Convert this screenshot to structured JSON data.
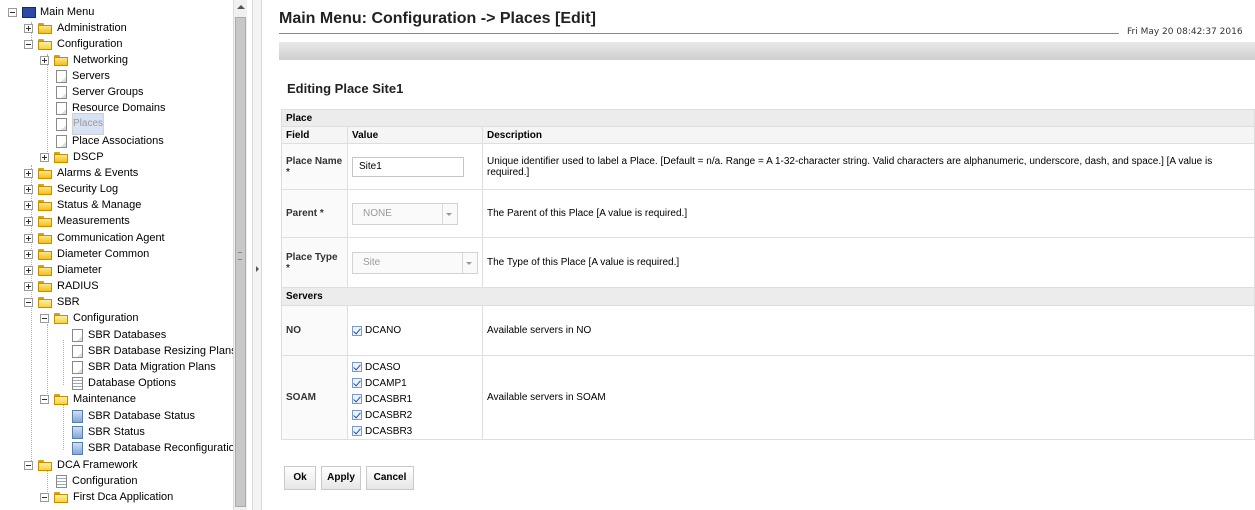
{
  "tree": {
    "items": [
      {
        "label": "Main Menu",
        "icon": "monitor-icon",
        "toggle": "minus"
      },
      {
        "label": "Administration",
        "icon": "folder-icon",
        "toggle": "plus"
      },
      {
        "label": "Configuration",
        "icon": "folder-open-icon",
        "toggle": "minus"
      },
      {
        "label": "Networking",
        "icon": "folder-icon",
        "toggle": "plus"
      },
      {
        "label": "Servers",
        "icon": "document-icon"
      },
      {
        "label": "Server Groups",
        "icon": "document-icon"
      },
      {
        "label": "Resource Domains",
        "icon": "document-icon"
      },
      {
        "label": "Places",
        "icon": "document-icon",
        "selected": true
      },
      {
        "label": "Place Associations",
        "icon": "document-icon"
      },
      {
        "label": "DSCP",
        "icon": "folder-icon",
        "toggle": "plus"
      },
      {
        "label": "Alarms & Events",
        "icon": "folder-icon",
        "toggle": "plus"
      },
      {
        "label": "Security Log",
        "icon": "folder-icon",
        "toggle": "plus"
      },
      {
        "label": "Status & Manage",
        "icon": "folder-icon",
        "toggle": "plus"
      },
      {
        "label": "Measurements",
        "icon": "folder-icon",
        "toggle": "plus"
      },
      {
        "label": "Communication Agent",
        "icon": "folder-icon",
        "toggle": "plus"
      },
      {
        "label": "Diameter Common",
        "icon": "folder-icon",
        "toggle": "plus"
      },
      {
        "label": "Diameter",
        "icon": "folder-icon",
        "toggle": "plus"
      },
      {
        "label": "RADIUS",
        "icon": "folder-icon",
        "toggle": "plus"
      },
      {
        "label": "SBR",
        "icon": "folder-open-icon",
        "toggle": "minus"
      },
      {
        "label": "Configuration",
        "icon": "folder-open-icon",
        "toggle": "minus"
      },
      {
        "label": "SBR Databases",
        "icon": "document-icon"
      },
      {
        "label": "SBR Database Resizing Plans",
        "icon": "document-icon"
      },
      {
        "label": "SBR Data Migration Plans",
        "icon": "document-icon"
      },
      {
        "label": "Database Options",
        "icon": "options-document-icon"
      },
      {
        "label": "Maintenance",
        "icon": "folder-open-icon",
        "toggle": "minus"
      },
      {
        "label": "SBR Database Status",
        "icon": "status-document-icon"
      },
      {
        "label": "SBR Status",
        "icon": "status-document-icon"
      },
      {
        "label": "SBR Database Reconfiguration S",
        "icon": "status-document-icon"
      },
      {
        "label": "DCA Framework",
        "icon": "folder-open-icon",
        "toggle": "minus"
      },
      {
        "label": "Configuration",
        "icon": "options-document-icon"
      },
      {
        "label": "First Dca Application",
        "icon": "folder-open-icon",
        "toggle": "minus"
      }
    ]
  },
  "header": {
    "title": "Main Menu: Configuration -> Places [Edit]",
    "datetime": "Fri May 20 08:42:37 2016"
  },
  "form": {
    "heading": "Editing Place Site1",
    "place_section": "Place",
    "columns": {
      "field": "Field",
      "value": "Value",
      "description": "Description"
    },
    "place_name": {
      "label": "Place Name *",
      "value": "Site1",
      "description": "Unique identifier used to label a Place. [Default = n/a. Range = A 1-32-character string. Valid characters are alphanumeric, underscore, dash, and space.] [A value is required.]"
    },
    "parent": {
      "label": "Parent *",
      "value": "NONE",
      "description": "The Parent of this Place [A value is required.]"
    },
    "place_type": {
      "label": "Place Type *",
      "value": "Site",
      "description": "The Type of this Place [A value is required.]"
    },
    "servers_section": "Servers",
    "no": {
      "label": "NO",
      "servers": [
        {
          "name": "DCANO",
          "checked": true
        }
      ],
      "description": "Available servers in NO"
    },
    "soam": {
      "label": "SOAM",
      "servers": [
        {
          "name": "DCASO",
          "checked": true
        },
        {
          "name": "DCAMP1",
          "checked": true
        },
        {
          "name": "DCASBR1",
          "checked": true
        },
        {
          "name": "DCASBR2",
          "checked": true
        },
        {
          "name": "DCASBR3",
          "checked": true
        }
      ],
      "description": "Available servers in SOAM"
    }
  },
  "buttons": {
    "ok": "Ok",
    "apply": "Apply",
    "cancel": "Cancel"
  }
}
